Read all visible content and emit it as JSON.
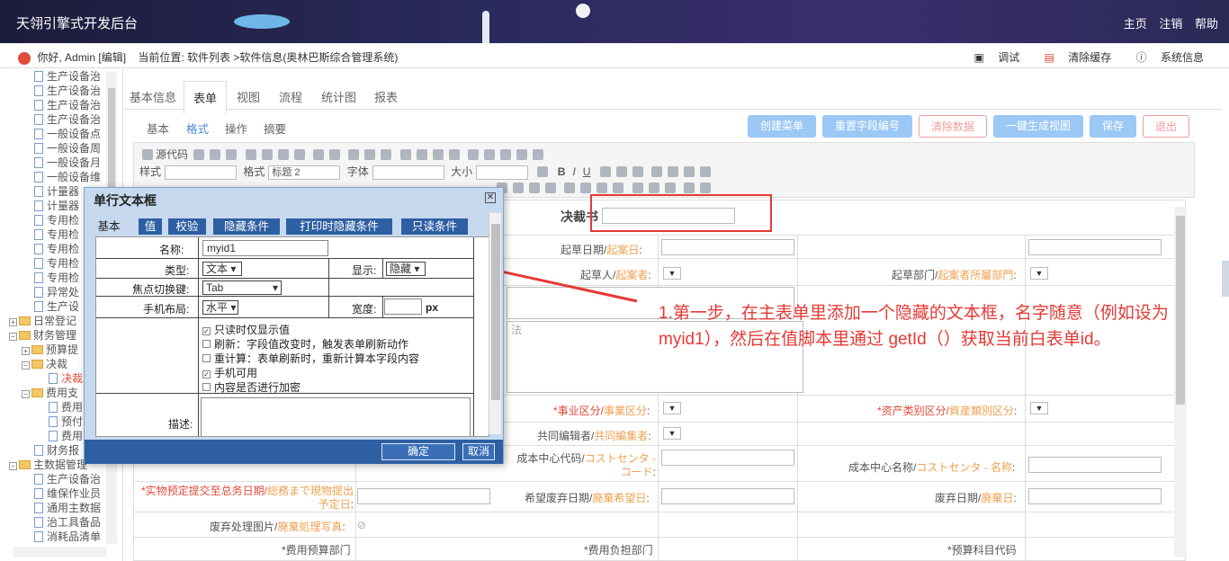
{
  "header": {
    "title": "天翎引擎式开发后台",
    "links": [
      "主页",
      "注销",
      "帮助"
    ]
  },
  "infobar": {
    "greeting": "你好, Admin [编辑]",
    "location": "当前位置: 软件列表 >软件信息(奥林巴斯综合管理系统)",
    "actions": [
      "调试",
      "清除缓存",
      "系统信息"
    ]
  },
  "tree": [
    {
      "label": "生产设备治",
      "kind": "doc"
    },
    {
      "label": "生产设备治",
      "kind": "doc"
    },
    {
      "label": "生产设备治",
      "kind": "doc"
    },
    {
      "label": "生产设备治",
      "kind": "doc"
    },
    {
      "label": "一般设备点",
      "kind": "doc"
    },
    {
      "label": "一般设备周",
      "kind": "doc"
    },
    {
      "label": "一般设备月",
      "kind": "doc"
    },
    {
      "label": "一般设备维",
      "kind": "doc"
    },
    {
      "label": "计量器",
      "kind": "doc"
    },
    {
      "label": "计量器",
      "kind": "doc"
    },
    {
      "label": "专用检",
      "kind": "doc"
    },
    {
      "label": "专用检",
      "kind": "doc"
    },
    {
      "label": "专用检",
      "kind": "doc"
    },
    {
      "label": "专用检",
      "kind": "doc"
    },
    {
      "label": "专用检",
      "kind": "doc"
    },
    {
      "label": "异常处",
      "kind": "doc"
    },
    {
      "label": "生产设",
      "kind": "doc"
    },
    {
      "label": "日常登记",
      "kind": "folder-root"
    },
    {
      "label": "财务管理",
      "kind": "folder-root-open"
    },
    {
      "label": "预算提",
      "kind": "folder"
    },
    {
      "label": "决裁",
      "kind": "folder-open"
    },
    {
      "label": "决裁",
      "kind": "doc-red"
    },
    {
      "label": "费用支",
      "kind": "folder-open"
    },
    {
      "label": "费用",
      "kind": "doc-deep"
    },
    {
      "label": "预付",
      "kind": "doc-deep"
    },
    {
      "label": "费用",
      "kind": "doc-deep"
    },
    {
      "label": "财务报",
      "kind": "doc"
    },
    {
      "label": "主数据管理",
      "kind": "folder-root-open"
    },
    {
      "label": "生产设备治",
      "kind": "doc"
    },
    {
      "label": "维保作业员",
      "kind": "doc"
    },
    {
      "label": "通用主数据",
      "kind": "doc"
    },
    {
      "label": "治工具备品",
      "kind": "doc"
    },
    {
      "label": "消耗品清单",
      "kind": "doc"
    }
  ],
  "tabs": [
    "基本信息",
    "表单",
    "视图",
    "流程",
    "统计图",
    "报表"
  ],
  "subtabs": [
    "基本",
    "格式",
    "操作",
    "摘要"
  ],
  "buttons": {
    "create_menu": "创建菜单",
    "reset_field": "重置字段编号",
    "clear_data": "清除数据",
    "gen_view": "一键生成视图",
    "save": "保存",
    "exit": "退出"
  },
  "toolbar": {
    "source": "源代码",
    "style": "样式",
    "format": "格式",
    "format_value": "标题 2",
    "font": "字体",
    "size": "大小"
  },
  "form": {
    "title": "决裁书",
    "draft_date": {
      "label": "起草日期/",
      "jp": "起案日",
      "suffix": ":"
    },
    "drafter": {
      "label": "起草人/",
      "jp": "起案者",
      "suffix": ":"
    },
    "draft_dept": {
      "label": "起草部门/",
      "jp": "起案者所屬部門",
      "suffix": ":"
    },
    "business": {
      "label": "*事业区分/",
      "jp": "事業区分",
      "suffix": ":"
    },
    "asset": {
      "label": "*资产类别区分/",
      "jp": "資産類別区分",
      "suffix": ":"
    },
    "co_editor": {
      "label": "共同编辑者/",
      "jp": "共同編集者",
      "suffix": ":"
    },
    "cost_code": {
      "label": "成本中心代码/",
      "jp": "コストセンタ - コード",
      "suffix": ":"
    },
    "cost_name": {
      "label": "成本中心名称/",
      "jp": "コストセンタ - 名称",
      "suffix": ":"
    },
    "scheduled": {
      "label": "*实物预定提交至总务日期/",
      "jp": "総務まで現物提出予定日",
      "suffix": ":"
    },
    "hope_date": {
      "label": "希望废弃日期/",
      "jp": "廃棄希望日",
      "suffix": ":"
    },
    "scrap_date": {
      "label": "废弃日期/",
      "jp": "廃棄日",
      "suffix": ":"
    },
    "scrap_photo": {
      "label": "废弃处理图片/",
      "jp": "廃棄処理写真",
      "suffix": ":"
    },
    "cost_dept": "*费用预算部门",
    "cost_bear": "*费用负担部门",
    "budget_code": "*预算科目代码",
    "method_hint": "法"
  },
  "dialog": {
    "title": "单行文本框",
    "close": "⊠",
    "tabs": [
      "基本",
      "值",
      "校验",
      "隐藏条件",
      "打印时隐藏条件",
      "只读条件"
    ],
    "name_label": "名称:",
    "name_value": "myid1",
    "type_label": "类型:",
    "type_value": "文本",
    "display_label": "显示:",
    "display_value": "隐藏",
    "focus_label": "焦点切换键:",
    "focus_value": "Tab",
    "mobile_label": "手机布局:",
    "mobile_value": "水平",
    "width_label": "宽度:",
    "width_unit": "px",
    "options": [
      {
        "label": "只读时仅显示值",
        "checked": true
      },
      {
        "label": "刷新：字段值改变时，触发表单刷新动作",
        "checked": false
      },
      {
        "label": "重计算：表单刷新时，重新计算本字段内容",
        "checked": false
      },
      {
        "label": "手机可用",
        "checked": true
      },
      {
        "label": "内容是否进行加密",
        "checked": false
      }
    ],
    "desc_label": "描述:",
    "ok": "确定",
    "cancel": "取消"
  },
  "annotation": {
    "line1": "1.第一步，在主表单里添加一个隐藏的文本框，名字随意（例如设为",
    "line2": "myid1），然后在值脚本里通过 getId（）获取当前白表单id。"
  },
  "colors": {
    "accent": "#4a8bd1",
    "highlight": "#e53935",
    "dialog_bar": "#2e5fa3"
  }
}
